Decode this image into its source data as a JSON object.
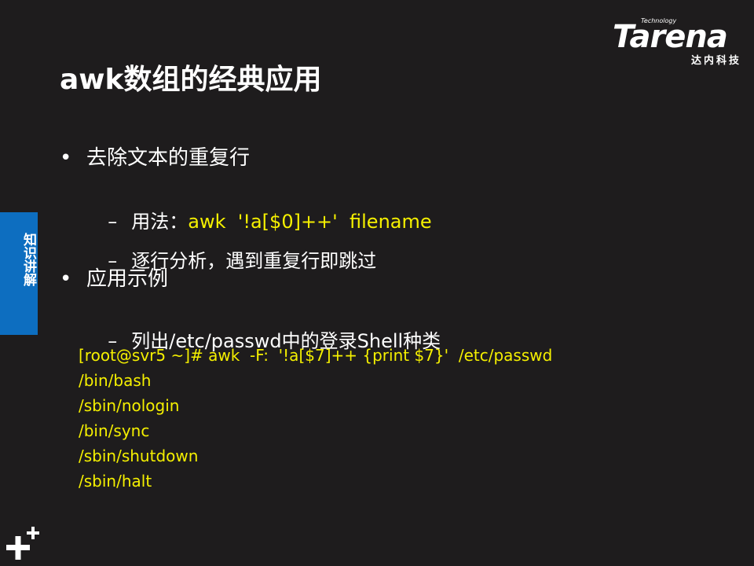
{
  "logo": {
    "tech": "Technology",
    "brand": "Tarena",
    "sub": "达内科技"
  },
  "title": "awk数组的经典应用",
  "side_tab": "知识讲解",
  "bullets": [
    {
      "text": "去除文本的重复行",
      "subs": [
        {
          "label": "用法：",
          "highlight": "awk  '!a[$0]++'  filename"
        },
        {
          "label": "逐行分析，遇到重复行即跳过",
          "highlight": ""
        }
      ]
    },
    {
      "text": "应用示例",
      "subs": [
        {
          "label": "列出/etc/passwd中的登录Shell种类",
          "highlight": ""
        }
      ]
    }
  ],
  "code_lines": [
    "[root@svr5 ~]# awk  -F:  '!a[$7]++ {print $7}'  /etc/passwd",
    "/bin/bash",
    "/sbin/nologin",
    "/bin/sync",
    "/sbin/shutdown",
    "/sbin/halt"
  ]
}
